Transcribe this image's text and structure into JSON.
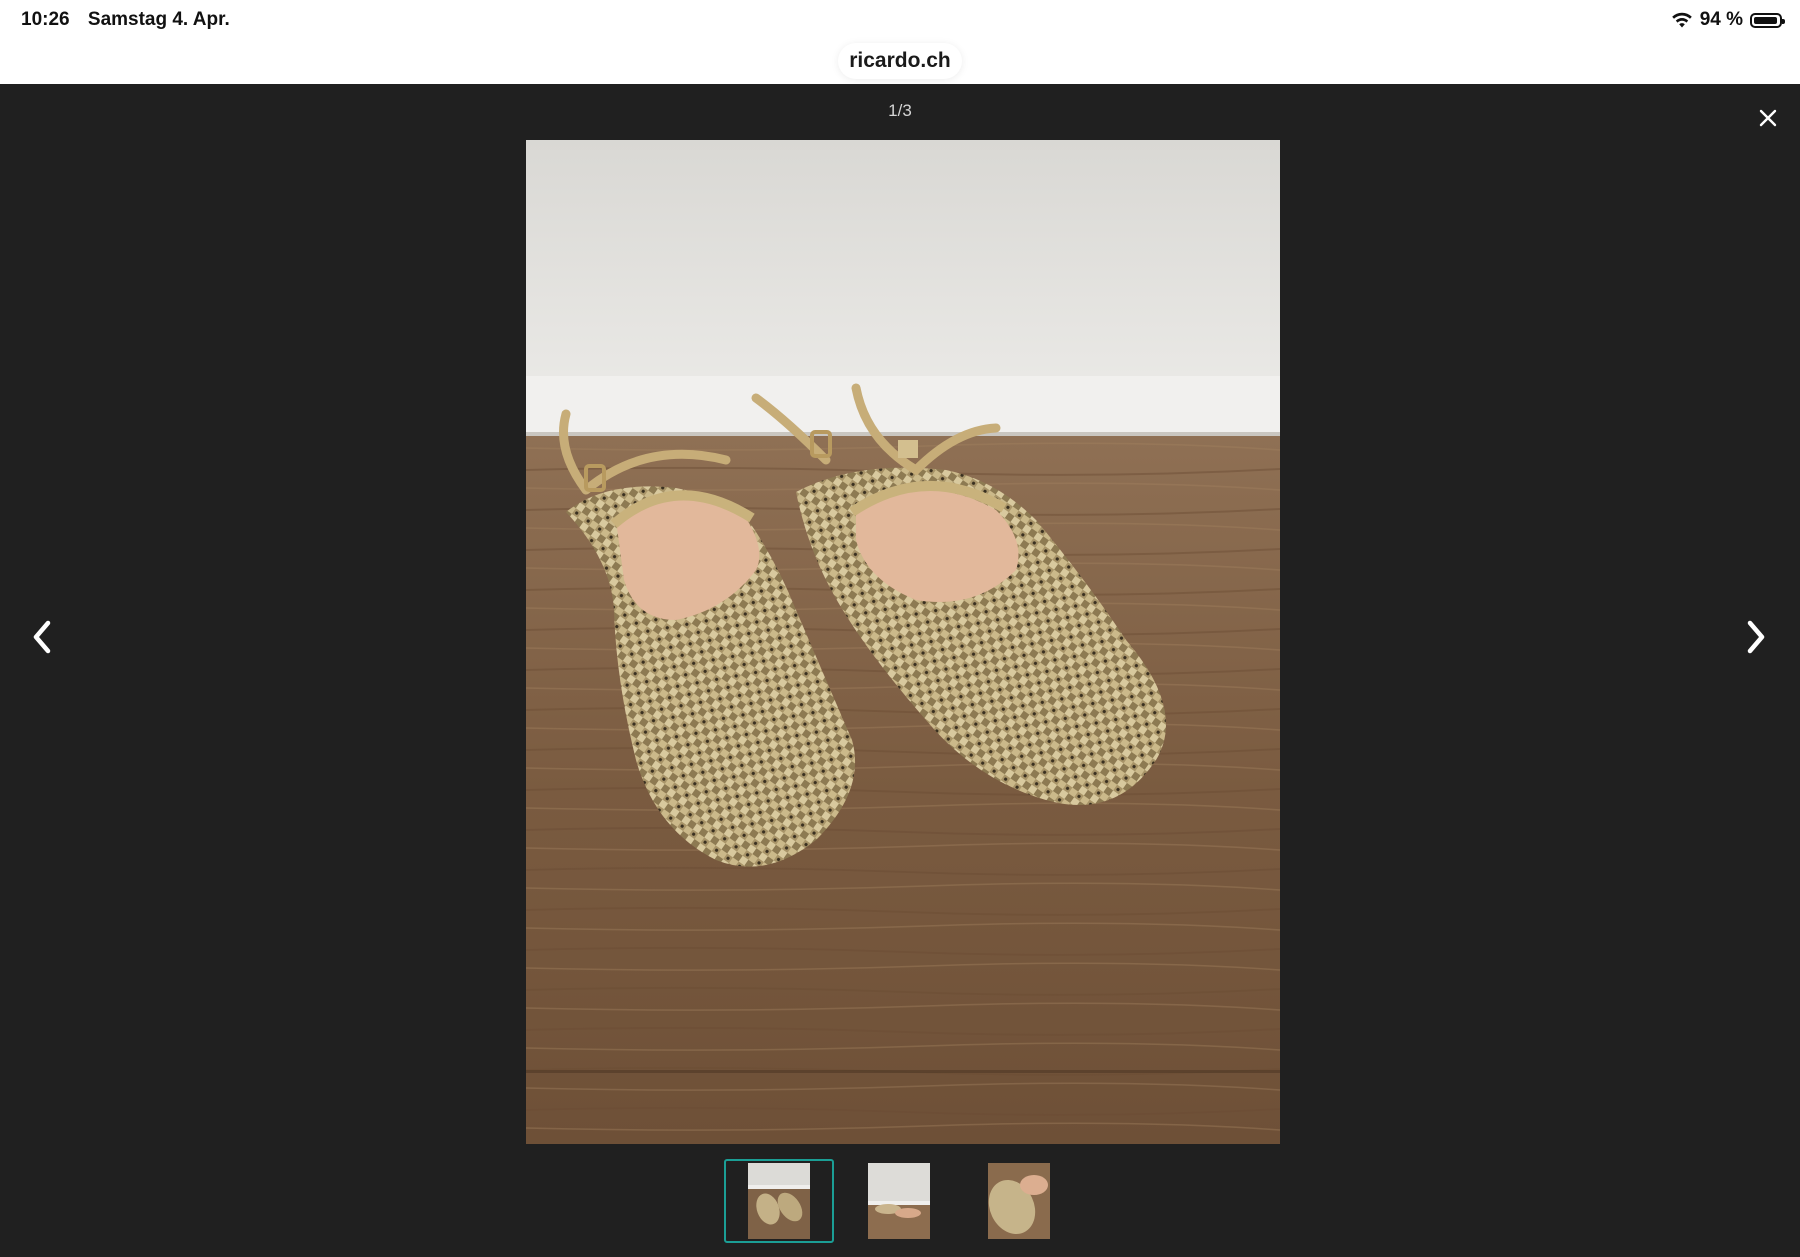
{
  "status_bar": {
    "time": "10:26",
    "date": "Samstag 4. Apr.",
    "battery_percent_label": "94 %",
    "battery_level": 0.94,
    "icons": [
      "wifi-icon",
      "battery-icon"
    ]
  },
  "browser": {
    "url": "ricardo.ch"
  },
  "gallery": {
    "counter": "1/3",
    "current_index": 1,
    "total": 3,
    "icons": {
      "close": "close-icon",
      "previous": "chevron-left-icon",
      "next": "chevron-right-icon"
    },
    "thumbnails": [
      {
        "selected": true
      },
      {
        "selected": false
      },
      {
        "selected": false
      }
    ],
    "colors": {
      "backdrop": "#202020",
      "active_thumbnail_border": "#1b9e95",
      "counter_text": "#d4d4d4"
    }
  }
}
